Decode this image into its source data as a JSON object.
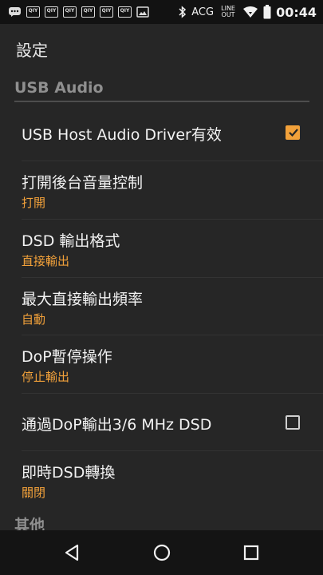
{
  "status_bar": {
    "notification_icons": [
      "chat-icon",
      "qiy-icon",
      "qiy-icon",
      "qiy-icon",
      "qiy-icon",
      "qiy-icon",
      "qiy-icon",
      "image-icon"
    ],
    "notification_badge": "QIY",
    "acg": "ACG",
    "line": "LINE",
    "out": "OUT",
    "time": "00:44"
  },
  "title": "設定",
  "sections": [
    {
      "title": "USB Audio"
    },
    {
      "title": "其他"
    }
  ],
  "items": [
    {
      "label": "USB Host Audio Driver有效",
      "type": "checkbox",
      "checked": true
    },
    {
      "label": "打開後台音量控制",
      "value": "打開"
    },
    {
      "label": "DSD 輸出格式",
      "value": "直接輸出"
    },
    {
      "label": "最大直接輸出頻率",
      "value": "自動"
    },
    {
      "label": "DoP暫停操作",
      "value": "停止輸出"
    },
    {
      "label": "通過DoP輸出3/6 MHz DSD",
      "type": "checkbox",
      "checked": false
    },
    {
      "label": "即時DSD轉換",
      "value": "關閉"
    }
  ],
  "accent_color": "#f2a13a",
  "nav": [
    "back-icon",
    "home-icon",
    "recents-icon"
  ]
}
